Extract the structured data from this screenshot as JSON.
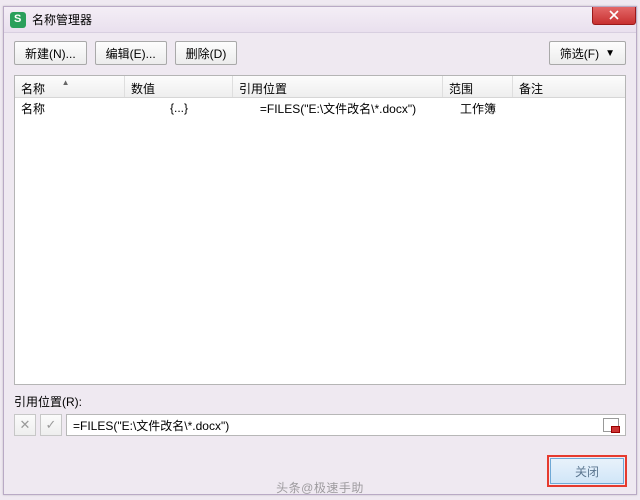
{
  "window": {
    "title": "名称管理器"
  },
  "toolbar": {
    "new_label": "新建(N)...",
    "edit_label": "编辑(E)...",
    "delete_label": "删除(D)",
    "filter_label": "筛选(F)"
  },
  "grid": {
    "headers": {
      "name": "名称",
      "value": "数值",
      "ref": "引用位置",
      "scope": "范围",
      "note": "备注"
    },
    "rows": [
      {
        "name": "名称",
        "value": "{...}",
        "ref": "=FILES(\"E:\\文件改名\\*.docx\")",
        "scope": "工作簿",
        "note": ""
      }
    ]
  },
  "ref_section": {
    "label": "引用位置(R):",
    "value": "=FILES(\"E:\\文件改名\\*.docx\")"
  },
  "footer": {
    "close_label": "关闭"
  },
  "watermark": "头条@极速手助"
}
